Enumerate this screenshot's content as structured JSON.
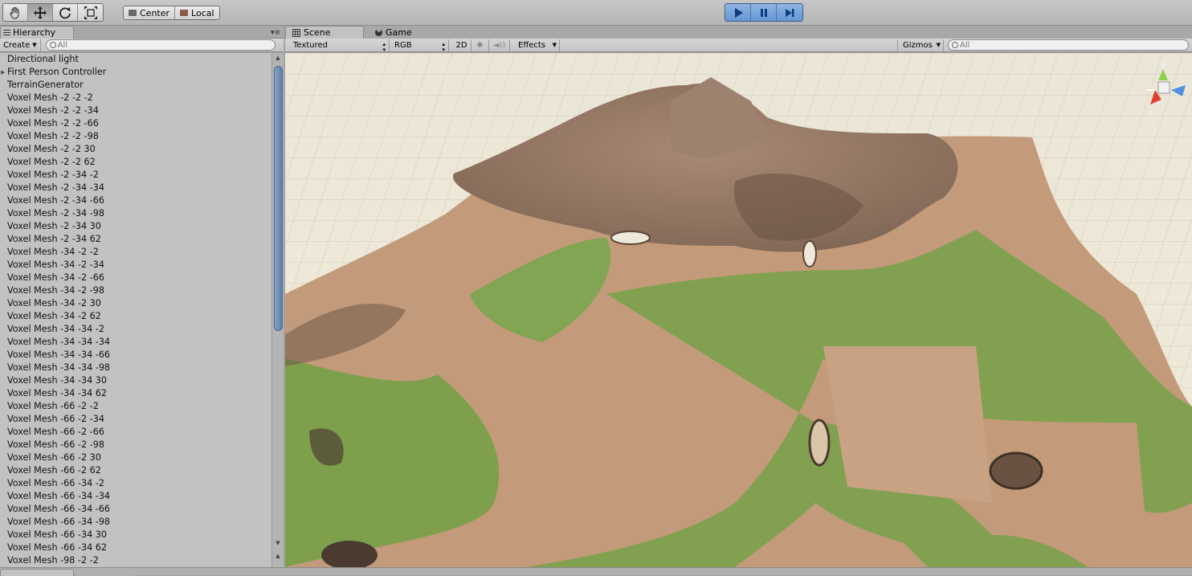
{
  "toolbar": {
    "transform_tools": [
      {
        "icon": "hand-icon",
        "name": "hand"
      },
      {
        "icon": "move-icon",
        "name": "move"
      },
      {
        "icon": "rotate-icon",
        "name": "rotate"
      },
      {
        "icon": "scale-icon",
        "name": "scale"
      }
    ],
    "pivot_label": "Center",
    "space_label": "Local",
    "playback": [
      {
        "icon": "play-icon"
      },
      {
        "icon": "pause-icon"
      },
      {
        "icon": "step-icon"
      }
    ]
  },
  "hierarchy": {
    "tab_label": "Hierarchy",
    "create_label": "Create",
    "search_placeholder": "All",
    "items": [
      {
        "label": "Directional light"
      },
      {
        "label": "First Person Controller",
        "has_children": true
      },
      {
        "label": "TerrainGenerator"
      },
      {
        "label": "Voxel Mesh -2 -2 -2"
      },
      {
        "label": "Voxel Mesh -2 -2 -34"
      },
      {
        "label": "Voxel Mesh -2 -2 -66"
      },
      {
        "label": "Voxel Mesh -2 -2 -98"
      },
      {
        "label": "Voxel Mesh -2 -2 30"
      },
      {
        "label": "Voxel Mesh -2 -2 62"
      },
      {
        "label": "Voxel Mesh -2 -34 -2"
      },
      {
        "label": "Voxel Mesh -2 -34 -34"
      },
      {
        "label": "Voxel Mesh -2 -34 -66"
      },
      {
        "label": "Voxel Mesh -2 -34 -98"
      },
      {
        "label": "Voxel Mesh -2 -34 30"
      },
      {
        "label": "Voxel Mesh -2 -34 62"
      },
      {
        "label": "Voxel Mesh -34 -2 -2"
      },
      {
        "label": "Voxel Mesh -34 -2 -34"
      },
      {
        "label": "Voxel Mesh -34 -2 -66"
      },
      {
        "label": "Voxel Mesh -34 -2 -98"
      },
      {
        "label": "Voxel Mesh -34 -2 30"
      },
      {
        "label": "Voxel Mesh -34 -2 62"
      },
      {
        "label": "Voxel Mesh -34 -34 -2"
      },
      {
        "label": "Voxel Mesh -34 -34 -34"
      },
      {
        "label": "Voxel Mesh -34 -34 -66"
      },
      {
        "label": "Voxel Mesh -34 -34 -98"
      },
      {
        "label": "Voxel Mesh -34 -34 30"
      },
      {
        "label": "Voxel Mesh -34 -34 62"
      },
      {
        "label": "Voxel Mesh -66 -2 -2"
      },
      {
        "label": "Voxel Mesh -66 -2 -34"
      },
      {
        "label": "Voxel Mesh -66 -2 -66"
      },
      {
        "label": "Voxel Mesh -66 -2 -98"
      },
      {
        "label": "Voxel Mesh -66 -2 30"
      },
      {
        "label": "Voxel Mesh -66 -2 62"
      },
      {
        "label": "Voxel Mesh -66 -34 -2"
      },
      {
        "label": "Voxel Mesh -66 -34 -34"
      },
      {
        "label": "Voxel Mesh -66 -34 -66"
      },
      {
        "label": "Voxel Mesh -66 -34 -98"
      },
      {
        "label": "Voxel Mesh -66 -34 30"
      },
      {
        "label": "Voxel Mesh -66 -34 62"
      },
      {
        "label": "Voxel Mesh -98 -2 -2"
      }
    ]
  },
  "scene": {
    "tabs": [
      {
        "label": "Scene",
        "icon": "grid-icon",
        "active": true
      },
      {
        "label": "Game",
        "icon": "game-icon",
        "active": false
      }
    ],
    "render_mode": "Textured",
    "color_mode": "RGB",
    "toggle_2d": "2D",
    "effects_label": "Effects",
    "gizmos_label": "Gizmos",
    "search_placeholder": "All",
    "gizmo_axes": [
      "y",
      "x"
    ],
    "colors": {
      "grass": "#7fa24f",
      "dirt": "#c39a78",
      "rock": "#8d7463",
      "grid": "#ece6d7"
    }
  }
}
